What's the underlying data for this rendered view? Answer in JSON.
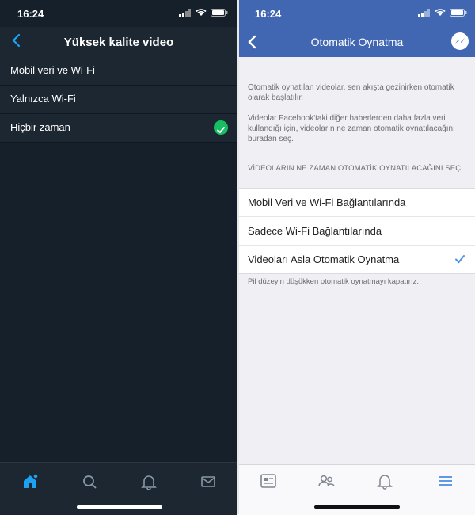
{
  "left": {
    "status_time": "16:24",
    "nav_title": "Yüksek kalite video",
    "items": [
      {
        "label": "Mobil veri ve Wi-Fi",
        "selected": false
      },
      {
        "label": "Yalnızca Wi-Fi",
        "selected": false
      },
      {
        "label": "Hiçbir zaman",
        "selected": true
      }
    ],
    "tabs": [
      "home-icon",
      "search-icon",
      "bell-icon",
      "mail-icon"
    ],
    "colors": {
      "bg": "#15202b",
      "accent": "#1da1f2",
      "check": "#17bf63"
    }
  },
  "right": {
    "status_time": "16:24",
    "nav_title": "Otomatik Oynatma",
    "intro_1": "Otomatik oynatılan videolar, sen akışta gezinirken otomatik olarak başlatılır.",
    "intro_2": "Videolar Facebook'taki diğer haberlerden daha fazla veri kullandığı için, videoların ne zaman otomatik oynatılacağını buradan seç.",
    "section_header": "VİDEOLARIN NE ZAMAN OTOMATİK OYNATILACAĞINI SEÇ:",
    "items": [
      {
        "label": "Mobil Veri ve Wi-Fi Bağlantılarında",
        "selected": false
      },
      {
        "label": "Sadece Wi-Fi Bağlantılarında",
        "selected": false
      },
      {
        "label": "Videoları Asla Otomatik Oynatma",
        "selected": true
      }
    ],
    "footer_note": "Pil düzeyin düşükken otomatik oynatmayı kapatırız.",
    "tabs": [
      "news-feed-icon",
      "friends-icon",
      "bell-icon",
      "menu-icon"
    ],
    "colors": {
      "brand": "#4267b2",
      "accent": "#4a90e2"
    }
  }
}
